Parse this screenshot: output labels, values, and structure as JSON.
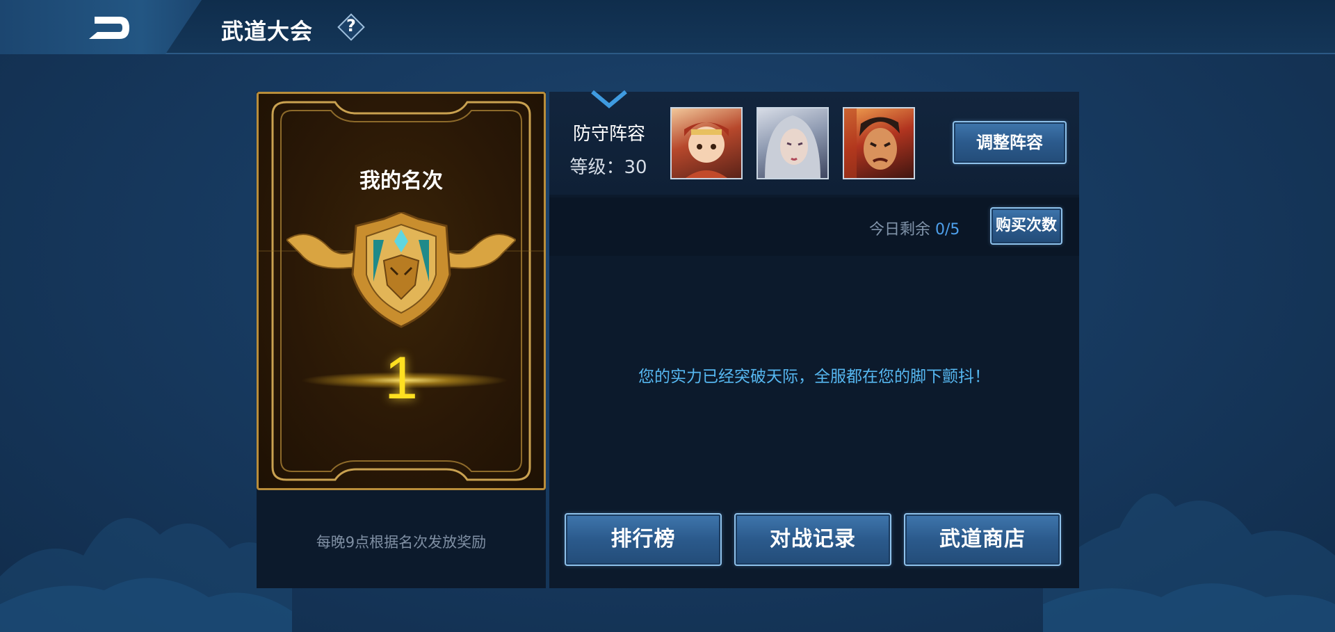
{
  "header": {
    "title": "武道大会",
    "help_label": "?"
  },
  "rank": {
    "label": "我的名次",
    "value": "1",
    "reward_note": "每晚9点根据名次发放奖励"
  },
  "lineup": {
    "title": "防守阵容",
    "level": "等级：30",
    "heroes": [
      "hero-portrait-1",
      "hero-portrait-2",
      "hero-portrait-3"
    ],
    "adjust_label": "调整阵容"
  },
  "attempts": {
    "label": "今日剩余 ",
    "count": "0/5",
    "buy_label": "购买次数"
  },
  "message": "您的实力已经突破天际，全服都在您的脚下颤抖！",
  "nav": {
    "ranking_label": "排行榜",
    "history_label": "对战记录",
    "shop_label": "武道商店"
  },
  "colors": {
    "accent_blue": "#56b7f0",
    "rank_gold": "#ffe021",
    "frame_gold": "#b98d3a"
  }
}
